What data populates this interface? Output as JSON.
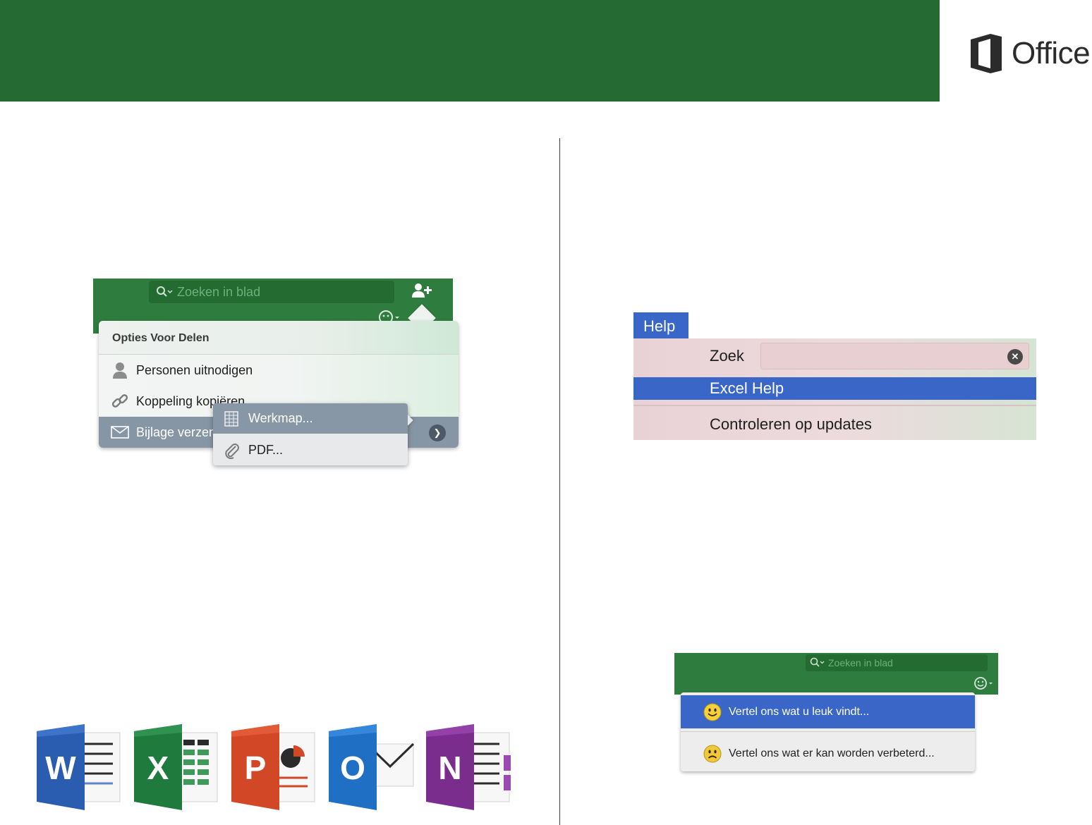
{
  "brand": {
    "logo_text": "Office",
    "banner_color": "#246a32"
  },
  "share_panel": {
    "search_placeholder": "Zoeken in blad",
    "header": "Opties Voor Delen",
    "items": [
      {
        "label": "Personen uitnodigen",
        "icon": "person-icon"
      },
      {
        "label": "Koppeling kopiëren",
        "icon": "link-icon"
      },
      {
        "label": "Bijlage verzenden",
        "icon": "envelope-icon",
        "selected": true
      }
    ],
    "submenu": [
      {
        "label": "Werkmap...",
        "icon": "spreadsheet-icon",
        "selected": true
      },
      {
        "label": "PDF...",
        "icon": "paperclip-icon"
      }
    ]
  },
  "help_menu": {
    "tab_label": "Help",
    "search_label": "Zoek",
    "items": [
      {
        "label": "Excel Help",
        "selected": true
      },
      {
        "label": "Controleren op updates"
      }
    ]
  },
  "feedback_menu": {
    "search_placeholder": "Zoeken in blad",
    "items": [
      {
        "label": "Vertel ons wat u leuk vindt...",
        "icon": "smiley-happy-icon",
        "selected": true
      },
      {
        "label": "Vertel ons wat er kan worden verbeterd...",
        "icon": "smiley-sad-icon"
      }
    ]
  },
  "app_icons": [
    {
      "letter": "W",
      "name": "word-icon",
      "color": "#2a5db0"
    },
    {
      "letter": "X",
      "name": "excel-icon",
      "color": "#1f7a3e"
    },
    {
      "letter": "P",
      "name": "powerpoint-icon",
      "color": "#d24726"
    },
    {
      "letter": "O",
      "name": "outlook-icon",
      "color": "#1f6fc5"
    },
    {
      "letter": "N",
      "name": "onenote-icon",
      "color": "#7b2d8e"
    }
  ],
  "colors": {
    "excel_green": "#2f7d3e",
    "selection_blue": "#3a67c7",
    "selection_gray": "#8796a4"
  }
}
